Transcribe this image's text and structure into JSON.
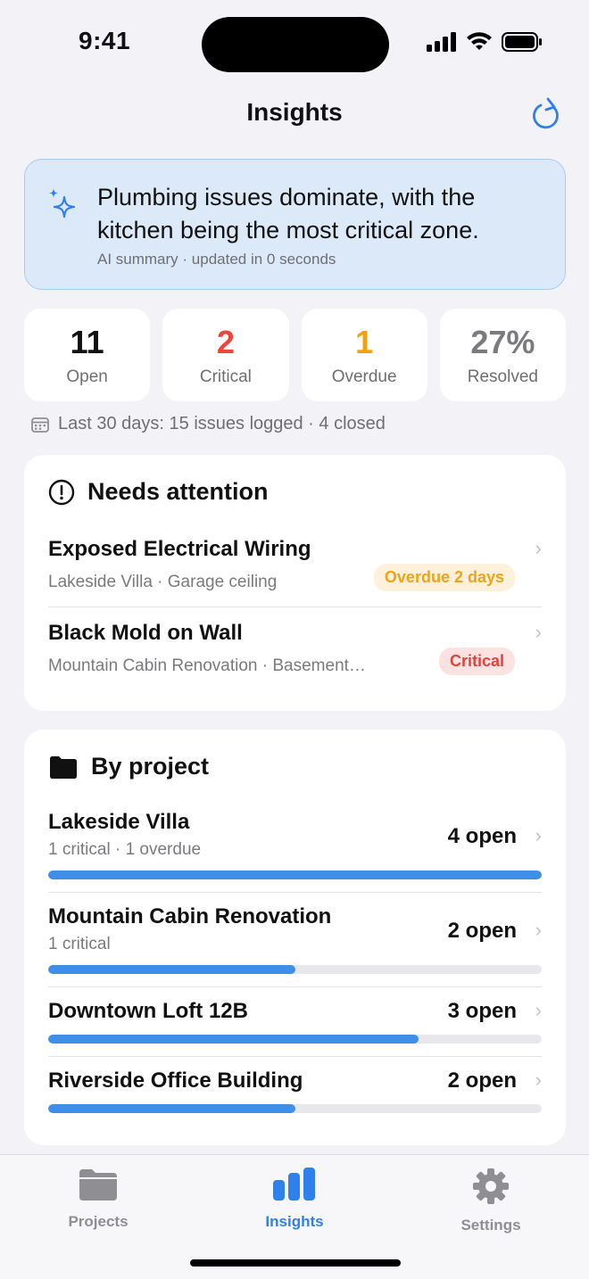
{
  "status_bar": {
    "time": "9:41"
  },
  "nav": {
    "title": "Insights",
    "refresh_icon": "refresh-icon"
  },
  "summary": {
    "text": "Plumbing issues dominate, with the kitchen being the most critical zone.",
    "meta": "AI summary · updated in 0 seconds",
    "icon": "sparkle-icon"
  },
  "stats": [
    {
      "value": "11",
      "label": "Open",
      "color": "#111111"
    },
    {
      "value": "2",
      "label": "Critical",
      "color": "#F0443A"
    },
    {
      "value": "1",
      "label": "Overdue",
      "color": "#F5A20A"
    },
    {
      "value": "27%",
      "label": "Resolved",
      "color": "#7A7A7F"
    }
  ],
  "period_text": "Last 30 days: 15 issues logged · 4 closed",
  "attention": {
    "title": "Needs attention",
    "items": [
      {
        "title": "Exposed Electrical Wiring",
        "subtitle": "Lakeside Villa · Garage ceiling",
        "badge": "Overdue 2 days",
        "badge_color": "#F0A317"
      },
      {
        "title": "Black Mold on Wall",
        "subtitle": "Mountain Cabin Renovation · Basement…",
        "badge": "Critical",
        "badge_color": "#E5413A"
      }
    ]
  },
  "projects": {
    "title": "By project",
    "items": [
      {
        "name": "Lakeside Villa",
        "subtitle": "1 critical · 1 overdue",
        "count": "4 open",
        "progress": 1.0
      },
      {
        "name": "Mountain Cabin Renovation",
        "subtitle": "1 critical",
        "count": "2 open",
        "progress": 0.5
      },
      {
        "name": "Downtown Loft 12B",
        "subtitle": "",
        "count": "3 open",
        "progress": 0.75
      },
      {
        "name": "Riverside Office Building",
        "subtitle": "",
        "count": "2 open",
        "progress": 0.5
      }
    ]
  },
  "tabs": [
    {
      "label": "Projects",
      "icon": "folder-icon",
      "active": false
    },
    {
      "label": "Insights",
      "icon": "chart-icon",
      "active": true
    },
    {
      "label": "Settings",
      "icon": "gear-icon",
      "active": false
    }
  ],
  "colors": {
    "accent": "#2F80ED",
    "bar": "#3F8FE8",
    "summary_bg": "#DCE9F8"
  }
}
